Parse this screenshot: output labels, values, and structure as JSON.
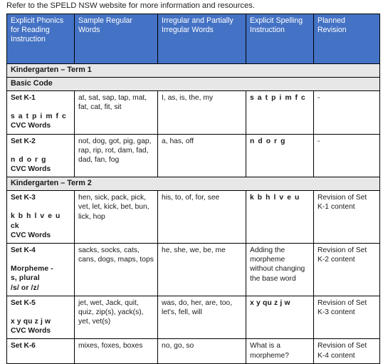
{
  "intro_note": "Refer to the SPELD NSW website for more information and resources.",
  "colors": {
    "header_blue": "#4472C4",
    "section_band_grey": "#E7E7E7",
    "border": "#000000",
    "text": "#231F20"
  },
  "table": {
    "headers": [
      "Explicit Phonics for Reading Instruction",
      "Sample Regular Words",
      "Irregular and Partially Irregular Words",
      "Explicit Spelling Instruction",
      "Planned Revision"
    ],
    "sections": [
      {
        "term_label": "Kindergarten – Term 1",
        "code_label": "Basic Code",
        "rows": [
          {
            "set": "Set K-1",
            "graphemes": "s a t p i m f c",
            "graphemes_spacing": "wide",
            "sub_lines": [],
            "word_type": "CVC Words",
            "sample_regular_words": "at, sat, sap, tap, mat, fat, cat, fit, sit",
            "irregular_words": "I, as, is, the, my",
            "explicit_spelling": "s a t p i m f c",
            "explicit_spelling_bold": true,
            "planned_revision": "-"
          },
          {
            "set": "Set K-2",
            "graphemes": "n d o r g",
            "graphemes_spacing": "wide",
            "sub_lines": [],
            "word_type": "CVC Words",
            "sample_regular_words": "not, dog, got, pig, gap, rap, rip, rot, dam, fad, dad, fan, fog",
            "irregular_words": "a, has, off",
            "explicit_spelling": "n d o r g",
            "explicit_spelling_bold": true,
            "planned_revision": "-"
          }
        ]
      },
      {
        "term_label": "Kindergarten – Term 2",
        "code_label": null,
        "rows": [
          {
            "set": "Set K-3",
            "graphemes": "k b h l v e u",
            "graphemes_spacing": "wide",
            "sub_lines": [
              "ck"
            ],
            "word_type": "CVC Words",
            "sample_regular_words": "hen, sick, pack, pick, vet, let, kick, bet, bun, lick, hop",
            "irregular_words": "his, to, of, for, see",
            "explicit_spelling": "k b h l v e u",
            "explicit_spelling_bold": true,
            "planned_revision": "Revision of Set K-1 content"
          },
          {
            "set": "Set K-4",
            "graphemes": "Morpheme -",
            "graphemes_spacing": "tight",
            "sub_lines": [
              "s, plural",
              "/s/ or /z/"
            ],
            "word_type": null,
            "sample_regular_words": "sacks, socks, cats, cans, dogs, maps, tops",
            "irregular_words": "he, she, we, be, me",
            "explicit_spelling": "Adding the morpheme without changing the base word",
            "explicit_spelling_bold": false,
            "planned_revision": "Revision of Set K-2 content"
          },
          {
            "set": "Set K-5",
            "graphemes": "x y qu z j w",
            "graphemes_spacing": "tight",
            "sub_lines": [],
            "word_type": "CVC Words",
            "sample_regular_words": "jet, wet, Jack, quit, quiz, zip(s), yack(s), yet, vet(s)",
            "irregular_words": "was, do, her, are, too, let's, fell, will",
            "explicit_spelling": "x y qu z j w",
            "explicit_spelling_bold": true,
            "explicit_spelling_tight": true,
            "planned_revision": "Revision of Set K-3 content"
          },
          {
            "set": "Set K-6",
            "graphemes": null,
            "graphemes_spacing": "tight",
            "sub_lines": [],
            "word_type": null,
            "sample_regular_words": "mixes, foxes, boxes",
            "irregular_words": "no, go, so",
            "explicit_spelling": "What is a morpheme?",
            "explicit_spelling_bold": false,
            "planned_revision": "Revision of Set K-4 content"
          }
        ]
      }
    ]
  }
}
